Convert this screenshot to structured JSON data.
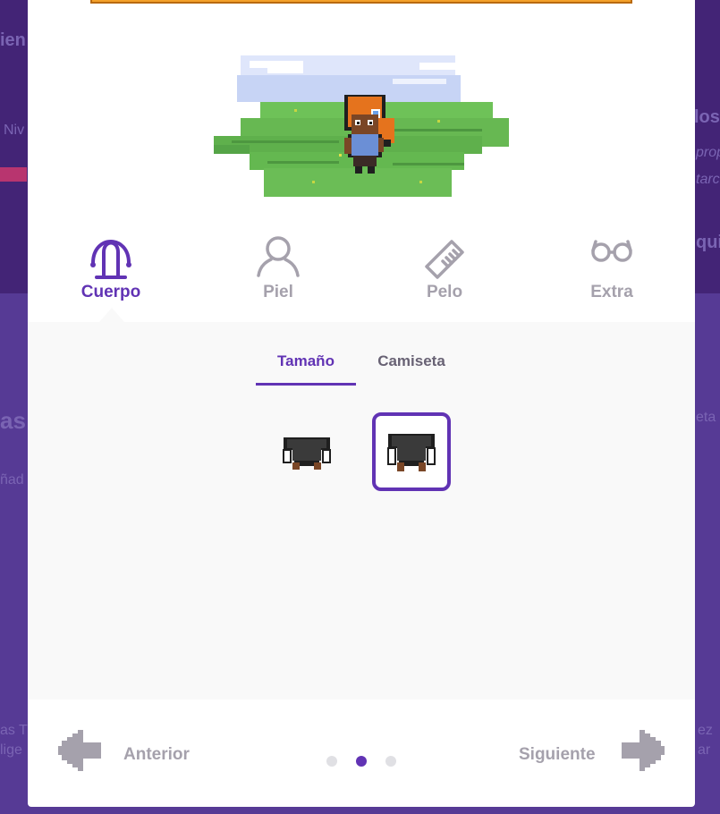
{
  "background": {
    "fragments": [
      "ien",
      "Niv",
      "los c",
      "prop",
      "tarc",
      "qui",
      "as",
      "ñad",
      "eta",
      "as T",
      "lige",
      "ez",
      "ar"
    ]
  },
  "categories": [
    {
      "label": "Cuerpo",
      "icon": "body-icon",
      "active": true
    },
    {
      "label": "Piel",
      "icon": "skin-icon",
      "active": false
    },
    {
      "label": "Pelo",
      "icon": "comb-icon",
      "active": false
    },
    {
      "label": "Extra",
      "icon": "glasses-icon",
      "active": false
    }
  ],
  "subtabs": [
    {
      "label": "Tamaño",
      "active": true
    },
    {
      "label": "Camiseta",
      "active": false
    }
  ],
  "options": [
    {
      "name": "slim-body-option",
      "selected": false
    },
    {
      "name": "broad-body-option",
      "selected": true
    }
  ],
  "footer": {
    "prev_label": "Anterior",
    "next_label": "Siguiente",
    "steps": 3,
    "current_step": 2
  },
  "colors": {
    "accent": "#6133b4",
    "inactive": "#a5a1ac",
    "panel": "#f9f9f9",
    "backdrop": "#4f2a93"
  }
}
